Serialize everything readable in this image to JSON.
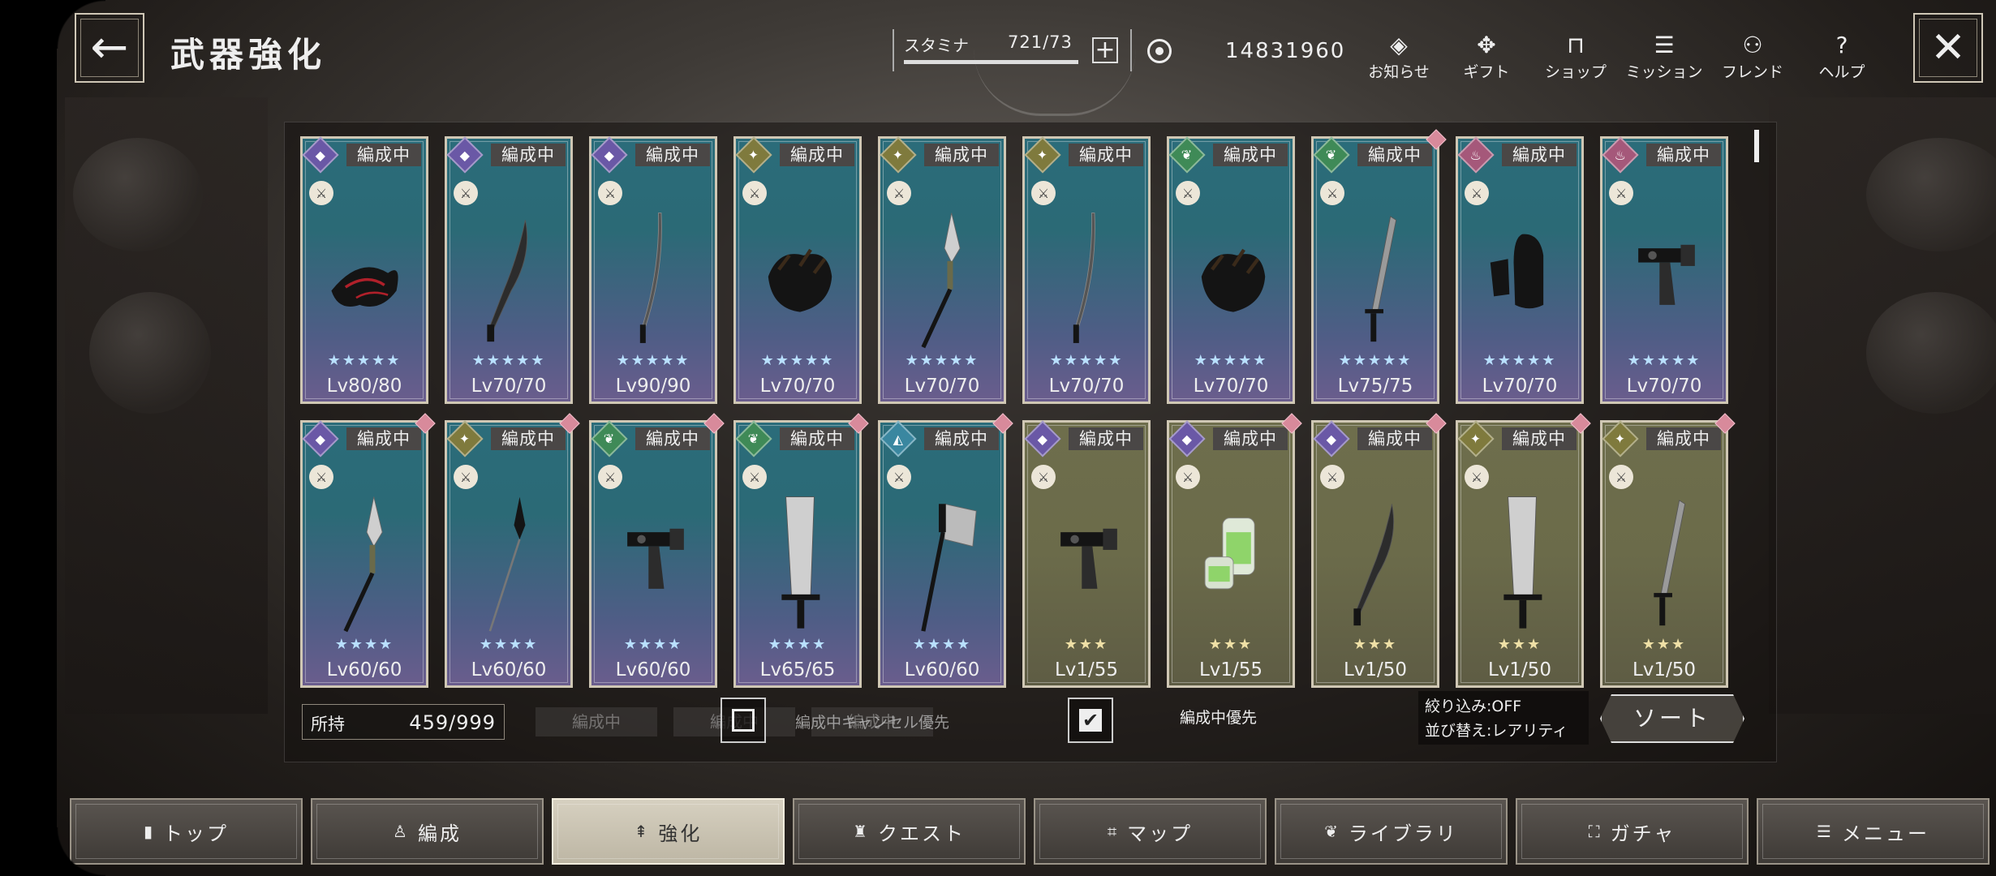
{
  "header": {
    "back_icon": "←",
    "title": "武器強化",
    "stamina_label": "スタミナ",
    "stamina_value": "721/73",
    "stamina_plus": "+",
    "coins": "14831960",
    "close_icon": "✕"
  },
  "topnav": [
    {
      "label": "お知らせ",
      "icon": "◈"
    },
    {
      "label": "ギフト",
      "icon": "✥"
    },
    {
      "label": "ショップ",
      "icon": "⊓"
    },
    {
      "label": "ミッション",
      "icon": "☰"
    },
    {
      "label": "フレンド",
      "icon": "⚇"
    },
    {
      "label": "ヘルプ",
      "icon": "?"
    }
  ],
  "badge_text": "編成中",
  "cards_row1": [
    {
      "lv": "Lv80/80",
      "stars": "★★★★★",
      "attr": "a-purple",
      "attr_icon": "◆",
      "bg": "bg-blue",
      "weapon": "claws-dark",
      "dia": false
    },
    {
      "lv": "Lv70/70",
      "stars": "★★★★★",
      "attr": "a-purple",
      "attr_icon": "◆",
      "bg": "bg-blue",
      "weapon": "blade-curved",
      "dia": false
    },
    {
      "lv": "Lv90/90",
      "stars": "★★★★★",
      "attr": "a-purple",
      "attr_icon": "◆",
      "bg": "bg-blue",
      "weapon": "katana",
      "dia": false
    },
    {
      "lv": "Lv70/70",
      "stars": "★★★★★",
      "attr": "a-gold",
      "attr_icon": "✦",
      "bg": "bg-blue",
      "weapon": "gauntlet",
      "dia": false
    },
    {
      "lv": "Lv70/70",
      "stars": "★★★★★",
      "attr": "a-gold",
      "attr_icon": "✦",
      "bg": "bg-blue",
      "weapon": "spear-broad",
      "dia": false
    },
    {
      "lv": "Lv70/70",
      "stars": "★★★★★",
      "attr": "a-gold",
      "attr_icon": "✦",
      "bg": "bg-blue",
      "weapon": "katana",
      "dia": false
    },
    {
      "lv": "Lv70/70",
      "stars": "★★★★★",
      "attr": "a-green",
      "attr_icon": "❦",
      "bg": "bg-blue",
      "weapon": "gauntlet",
      "dia": false
    },
    {
      "lv": "Lv75/75",
      "stars": "★★★★★",
      "attr": "a-green",
      "attr_icon": "❦",
      "bg": "bg-blue",
      "weapon": "sword",
      "dia": true
    },
    {
      "lv": "Lv70/70",
      "stars": "★★★★★",
      "attr": "a-pink",
      "attr_icon": "♨",
      "bg": "bg-blue",
      "weapon": "gloves",
      "dia": false
    },
    {
      "lv": "Lv70/70",
      "stars": "★★★★★",
      "attr": "a-pink",
      "attr_icon": "♨",
      "bg": "bg-blue",
      "weapon": "gun",
      "dia": false
    }
  ],
  "cards_row2": [
    {
      "lv": "Lv60/60",
      "stars": "★★★★",
      "attr": "a-purple",
      "attr_icon": "◆",
      "bg": "bg-blue",
      "weapon": "spear-broad",
      "dia": true
    },
    {
      "lv": "Lv60/60",
      "stars": "★★★★",
      "attr": "a-gold",
      "attr_icon": "✦",
      "bg": "bg-blue",
      "weapon": "spear-thin",
      "dia": true
    },
    {
      "lv": "Lv60/60",
      "stars": "★★★★",
      "attr": "a-green",
      "attr_icon": "❦",
      "bg": "bg-blue",
      "weapon": "gun",
      "dia": true
    },
    {
      "lv": "Lv65/65",
      "stars": "★★★★",
      "attr": "a-green",
      "attr_icon": "❦",
      "bg": "bg-blue",
      "weapon": "greatsword",
      "dia": true
    },
    {
      "lv": "Lv60/60",
      "stars": "★★★★",
      "attr": "a-cyan",
      "attr_icon": "◭",
      "bg": "bg-blue",
      "weapon": "axe",
      "dia": true
    },
    {
      "lv": "Lv1/55",
      "stars": "★★★",
      "attr": "a-purple",
      "attr_icon": "◆",
      "bg": "bg-olive",
      "weapon": "gun",
      "dia": false
    },
    {
      "lv": "Lv1/55",
      "stars": "★★★",
      "attr": "a-purple",
      "attr_icon": "◆",
      "bg": "bg-olive",
      "weapon": "canister",
      "dia": true
    },
    {
      "lv": "Lv1/50",
      "stars": "★★★",
      "attr": "a-purple",
      "attr_icon": "◆",
      "bg": "bg-olive",
      "weapon": "blade-curved",
      "dia": true
    },
    {
      "lv": "Lv1/50",
      "stars": "★★★",
      "attr": "a-gold",
      "attr_icon": "✦",
      "bg": "bg-olive",
      "weapon": "greatsword",
      "dia": true
    },
    {
      "lv": "Lv1/50",
      "stars": "★★★",
      "attr": "a-gold",
      "attr_icon": "✦",
      "bg": "bg-olive",
      "weapon": "sword",
      "dia": true
    }
  ],
  "controls": {
    "owned_label": "所持",
    "owned_value": "459/999",
    "check1_label": "編成中キャンセル優先",
    "check2_mark": "✔",
    "check2_label": "編成中優先",
    "filter": "絞り込み:OFF",
    "sort_by": "並び替え:レアリティ",
    "sort_button": "ソート"
  },
  "bottomnav": [
    {
      "label": "トップ",
      "icon": "▮",
      "active": false
    },
    {
      "label": "編成",
      "icon": "♙",
      "active": false
    },
    {
      "label": "強化",
      "icon": "⇞",
      "active": true
    },
    {
      "label": "クエスト",
      "icon": "♜",
      "active": false
    },
    {
      "label": "マップ",
      "icon": "⌗",
      "active": false
    },
    {
      "label": "ライブラリ",
      "icon": "❦",
      "active": false
    },
    {
      "label": "ガチャ",
      "icon": "⛶",
      "active": false
    },
    {
      "label": "メニュー",
      "icon": "☰",
      "active": false
    }
  ]
}
